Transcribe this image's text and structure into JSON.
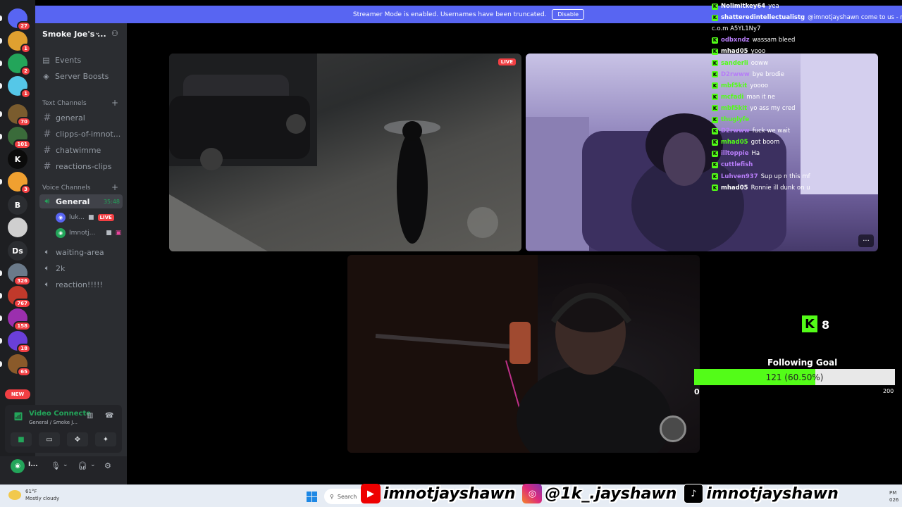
{
  "banner": {
    "text": "Streamer Mode is enabled. Usernames have been truncated.",
    "disable_label": "Disable"
  },
  "rail": {
    "servers": [
      {
        "label": "",
        "badge": "27",
        "color": "#5865f2",
        "icon": "discord-home-icon"
      },
      {
        "label": "",
        "badge": "1",
        "color": "#e0a030",
        "icon": "server-avatar-icon"
      },
      {
        "label": "",
        "badge": "2",
        "color": "#23a55a",
        "icon": "discord-icon"
      },
      {
        "label": "",
        "badge": "1",
        "color": "#55c7e8",
        "icon": "face-icon"
      },
      {
        "label": "",
        "badge": "70",
        "color": "#7a5c2e",
        "icon": "server-avatar-icon"
      },
      {
        "label": "",
        "badge": "101",
        "color": "#3a6b3a",
        "icon": "server-avatar-icon"
      },
      {
        "label": "K",
        "badge": "",
        "color": "#0b0b0b",
        "icon": "kick-icon"
      },
      {
        "label": "",
        "badge": "3",
        "color": "#f0a030",
        "icon": "server-avatar-icon"
      },
      {
        "label": "B",
        "badge": "",
        "color": "#2b2d31",
        "icon": "letter-icon"
      },
      {
        "label": "",
        "badge": "",
        "color": "#cfcfcf",
        "icon": "server-avatar-icon"
      },
      {
        "label": "Ds",
        "badge": "",
        "color": "#2b2d31",
        "icon": "letter-icon"
      },
      {
        "label": "",
        "badge": "326",
        "color": "#6b7a8a",
        "icon": "server-avatar-icon"
      },
      {
        "label": "",
        "badge": "767",
        "color": "#c0392b",
        "icon": "server-avatar-icon"
      },
      {
        "label": "",
        "badge": "158",
        "color": "#9b2fae",
        "icon": "server-avatar-icon"
      },
      {
        "label": "",
        "badge": "18",
        "color": "#6a3fd8",
        "icon": "server-avatar-icon"
      },
      {
        "label": "",
        "badge": "65",
        "color": "#8a5a2a",
        "icon": "server-avatar-icon"
      }
    ],
    "new_label": "NEW"
  },
  "sidebar": {
    "server_name": "Smoke Joe's ...",
    "nav": [
      {
        "label": "Events",
        "icon": "calendar-icon"
      },
      {
        "label": "Server Boosts",
        "icon": "boost-icon"
      }
    ],
    "text_category": "Text Channels",
    "text_channels": [
      "general",
      "clipps-of-imnot...",
      "chatwimme",
      "reactions-clips"
    ],
    "voice_category": "Voice Channels",
    "voice_channels": [
      {
        "label": "General",
        "timer": "35:48",
        "active": true
      },
      {
        "label": "waiting-area"
      },
      {
        "label": "2k"
      },
      {
        "label": "reaction!!!!!"
      }
    ],
    "voice_users": [
      {
        "name": "luk...",
        "live": "LIVE"
      },
      {
        "name": "Imnotj...",
        "live": ""
      }
    ]
  },
  "voice_panel": {
    "title": "Video Connecte",
    "subtitle": "General / Smoke J..."
  },
  "user_bar": {
    "name": "I..."
  },
  "tiles": {
    "live_label": "LIVE",
    "more_label": "···"
  },
  "chat": [
    {
      "name": "Nolimitkey64",
      "msg": "yea",
      "color": "#ffffff"
    },
    {
      "name": "shatteredintellectualistg",
      "msg": "@imnotjayshawn come to us - n.e.z",
      "color": "#ffffff"
    },
    {
      "name": "",
      "msg": "c.o.m A5YL1Ny7",
      "color": "#ffffff"
    },
    {
      "name": "odbxndz",
      "msg": "wassam bleed",
      "color": "#b67cf7"
    },
    {
      "name": "mhad05",
      "msg": "yooo",
      "color": "#ffffff"
    },
    {
      "name": "sanderli",
      "msg": "ooww",
      "color": "#53fc18"
    },
    {
      "name": "D2rwww",
      "msg": "bye brodie",
      "color": "#b67cf7"
    },
    {
      "name": "mbf5kit",
      "msg": "yoooo",
      "color": "#53fc18"
    },
    {
      "name": "mcfadi",
      "msg": "man it ne",
      "color": "#53fc18"
    },
    {
      "name": "mbf5kit",
      "msg": "yo ass my cred",
      "color": "#53fc18"
    },
    {
      "name": "thuglyfe",
      "msg": "",
      "color": "#53fc18"
    },
    {
      "name": "D2rwww",
      "msg": "fuck we wait",
      "color": "#b67cf7"
    },
    {
      "name": "mhad05",
      "msg": "got boom",
      "color": "#53fc18"
    },
    {
      "name": "illtoppie",
      "msg": "Ha",
      "color": "#b67cf7"
    },
    {
      "name": "cuttlefish",
      "msg": "",
      "color": "#b67cf7"
    },
    {
      "name": "Luhven937",
      "msg": "Sup up n this mf",
      "color": "#b67cf7"
    },
    {
      "name": "mhad05",
      "msg": "Ronnie ill dunk on u",
      "color": "#ffffff"
    }
  ],
  "goal": {
    "kick_count": "8",
    "title": "Following Goal",
    "text": "121 (60.50%)",
    "fraction": 0.605,
    "min": "0",
    "max": "200",
    "fill_color": "#53fc18"
  },
  "taskbar": {
    "temp": "61°F",
    "weather": "Mostly cloudy",
    "search": "Search",
    "clock_top": "PM",
    "clock_bottom": "026"
  },
  "socials": [
    {
      "platform": "youtube",
      "handle": "imnotjayshawn"
    },
    {
      "platform": "instagram",
      "handle": "@1k_.jayshawn"
    },
    {
      "platform": "tiktok",
      "handle": "imnotjayshawn"
    }
  ]
}
